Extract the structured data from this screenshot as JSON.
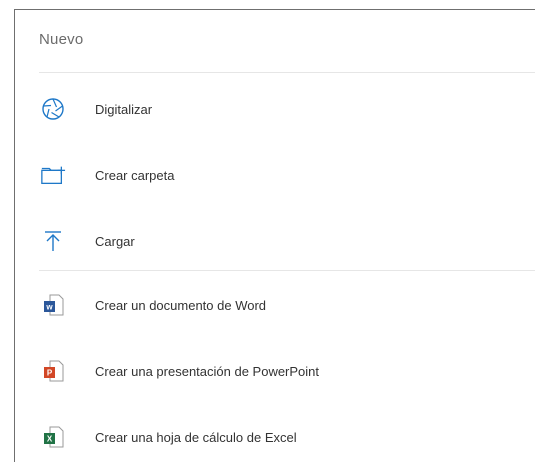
{
  "menu": {
    "title": "Nuevo",
    "items": [
      {
        "label": "Digitalizar",
        "icon": "camera-shutter-icon"
      },
      {
        "label": "Crear carpeta",
        "icon": "new-folder-icon"
      },
      {
        "label": "Cargar",
        "icon": "upload-icon"
      },
      {
        "label": "Crear un documento de Word",
        "icon": "word-icon"
      },
      {
        "label": "Crear una presentación de PowerPoint",
        "icon": "powerpoint-icon"
      },
      {
        "label": "Crear una hoja de cálculo de Excel",
        "icon": "excel-icon"
      }
    ]
  },
  "colors": {
    "accent": "#1e78c8",
    "word": "#2b579a",
    "powerpoint": "#d24726",
    "excel": "#217346"
  }
}
